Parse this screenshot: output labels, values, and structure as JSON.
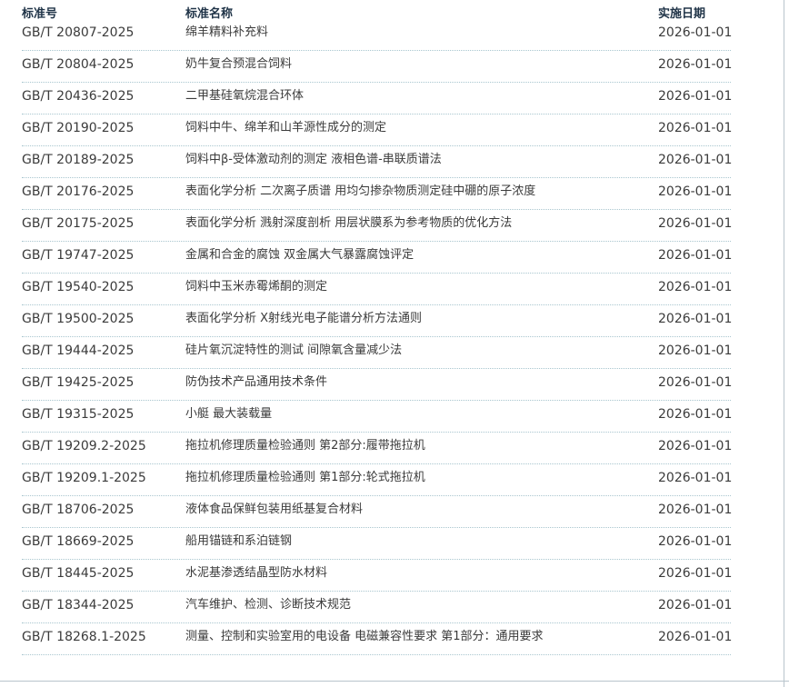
{
  "header": {
    "col_code": "标准号",
    "col_name": "标准名称",
    "col_date": "实施日期"
  },
  "rows": [
    {
      "code": "GB/T 20807-2025",
      "name": "绵羊精料补充料",
      "date": "2026-01-01"
    },
    {
      "code": "GB/T 20804-2025",
      "name": "奶牛复合预混合饲料",
      "date": "2026-01-01"
    },
    {
      "code": "GB/T 20436-2025",
      "name": "二甲基硅氧烷混合环体",
      "date": "2026-01-01"
    },
    {
      "code": "GB/T 20190-2025",
      "name": "饲料中牛、绵羊和山羊源性成分的测定",
      "date": "2026-01-01"
    },
    {
      "code": "GB/T 20189-2025",
      "name": "饲料中β-受体激动剂的测定 液相色谱-串联质谱法",
      "date": "2026-01-01"
    },
    {
      "code": "GB/T 20176-2025",
      "name": "表面化学分析 二次离子质谱 用均匀掺杂物质测定硅中硼的原子浓度",
      "date": "2026-01-01"
    },
    {
      "code": "GB/T 20175-2025",
      "name": "表面化学分析 溅射深度剖析 用层状膜系为参考物质的优化方法",
      "date": "2026-01-01"
    },
    {
      "code": "GB/T 19747-2025",
      "name": "金属和合金的腐蚀 双金属大气暴露腐蚀评定",
      "date": "2026-01-01"
    },
    {
      "code": "GB/T 19540-2025",
      "name": "饲料中玉米赤霉烯酮的测定",
      "date": "2026-01-01"
    },
    {
      "code": "GB/T 19500-2025",
      "name": "表面化学分析 X射线光电子能谱分析方法通则",
      "date": "2026-01-01"
    },
    {
      "code": "GB/T 19444-2025",
      "name": "硅片氧沉淀特性的测试 间隙氧含量减少法",
      "date": "2026-01-01"
    },
    {
      "code": "GB/T 19425-2025",
      "name": "防伪技术产品通用技术条件",
      "date": "2026-01-01"
    },
    {
      "code": "GB/T 19315-2025",
      "name": "小艇 最大装载量",
      "date": "2026-01-01"
    },
    {
      "code": "GB/T 19209.2-2025",
      "name": "拖拉机修理质量检验通则 第2部分:履带拖拉机",
      "date": "2026-01-01"
    },
    {
      "code": "GB/T 19209.1-2025",
      "name": "拖拉机修理质量检验通则 第1部分:轮式拖拉机",
      "date": "2026-01-01"
    },
    {
      "code": "GB/T 18706-2025",
      "name": "液体食品保鲜包装用纸基复合材料",
      "date": "2026-01-01"
    },
    {
      "code": "GB/T 18669-2025",
      "name": "船用锚链和系泊链钢",
      "date": "2026-01-01"
    },
    {
      "code": "GB/T 18445-2025",
      "name": "水泥基渗透结晶型防水材料",
      "date": "2026-01-01"
    },
    {
      "code": "GB/T 18344-2025",
      "name": "汽车维护、检测、诊断技术规范",
      "date": "2026-01-01"
    },
    {
      "code": "GB/T 18268.1-2025",
      "name": "测量、控制和实验室用的电设备 电磁兼容性要求 第1部分：通用要求",
      "date": "2026-01-01"
    }
  ]
}
